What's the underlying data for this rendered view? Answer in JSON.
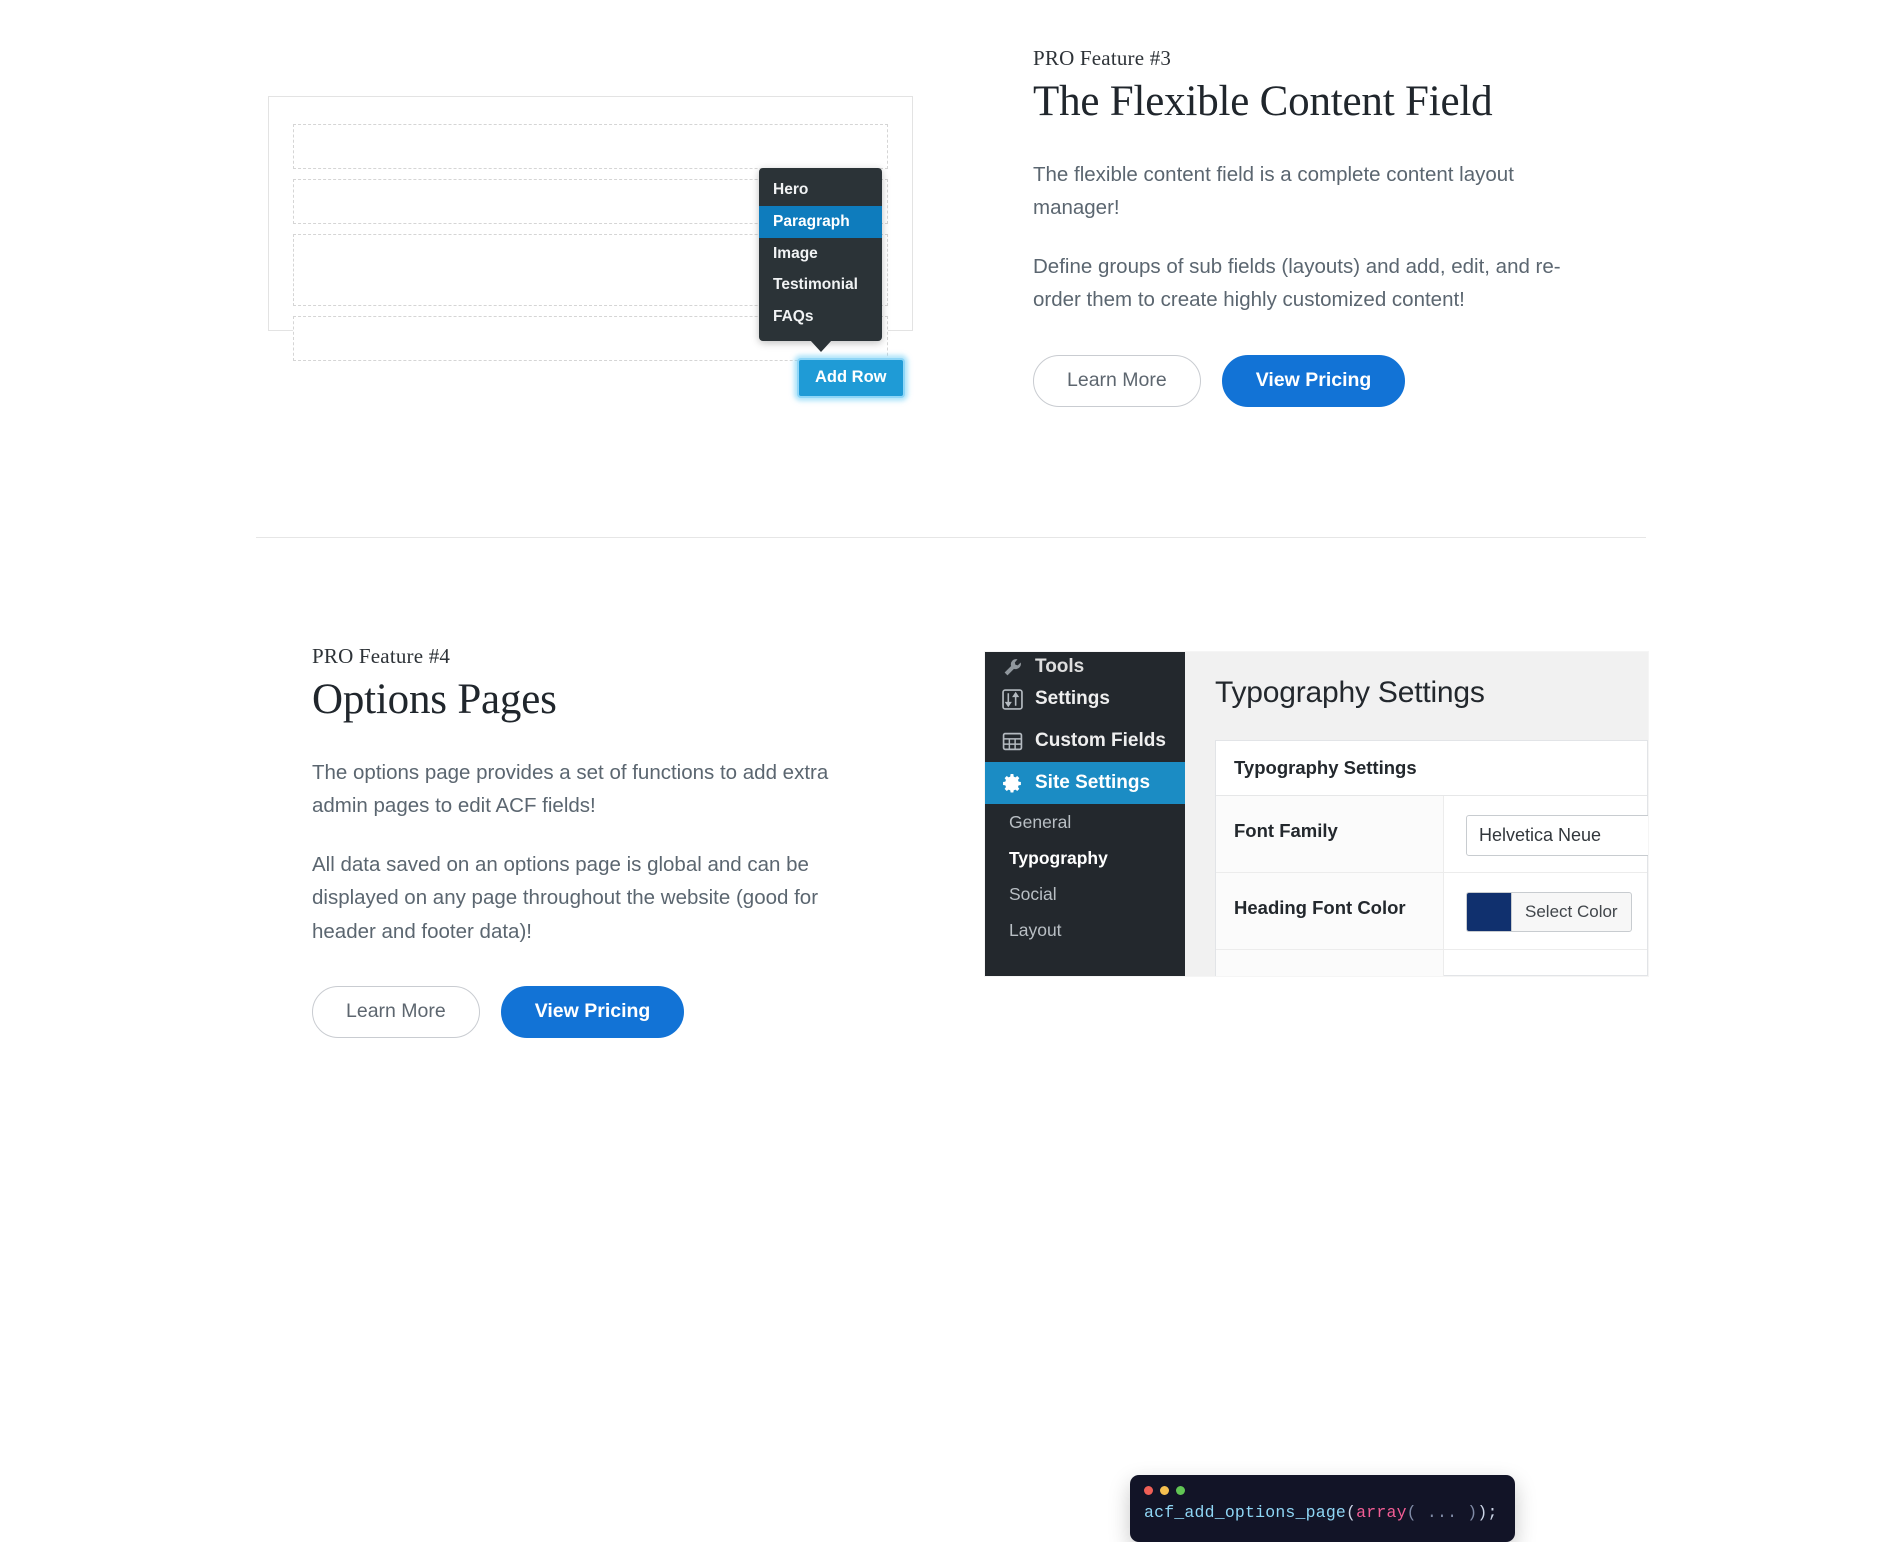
{
  "sections": [
    {
      "eyebrow": "PRO Feature #3",
      "title": "The Flexible Content Field",
      "paragraphs": [
        "The flexible content field is a complete content layout manager!",
        "Define groups of sub fields (layouts) and add, edit, and re-order them to create highly customized content!"
      ],
      "buttons": {
        "secondary": "Learn More",
        "primary": "View Pricing"
      }
    },
    {
      "eyebrow": "PRO Feature #4",
      "title": "Options Pages",
      "paragraphs": [
        "The options page provides a set of functions to add extra admin pages to edit ACF fields!",
        "All data saved on an options page is global and can be displayed on any page throughout the website (good for header and footer data)!"
      ],
      "buttons": {
        "secondary": "Learn More",
        "primary": "View Pricing"
      }
    }
  ],
  "flexible_content_mock": {
    "dropdown_items": [
      {
        "label": "Hero",
        "selected": false
      },
      {
        "label": "Paragraph",
        "selected": true
      },
      {
        "label": "Image",
        "selected": false
      },
      {
        "label": "Testimonial",
        "selected": false
      },
      {
        "label": "FAQs",
        "selected": false
      }
    ],
    "add_row_label": "Add Row"
  },
  "wp_screenshot": {
    "nav_items": [
      {
        "label": "Tools",
        "icon": "wrench-icon",
        "state": "partial"
      },
      {
        "label": "Settings",
        "icon": "sliders-icon",
        "state": "normal"
      },
      {
        "label": "Custom Fields",
        "icon": "table-icon",
        "state": "normal"
      },
      {
        "label": "Site Settings",
        "icon": "gear-icon",
        "state": "active"
      }
    ],
    "sub_items": [
      {
        "label": "General",
        "current": false
      },
      {
        "label": "Typography",
        "current": true
      },
      {
        "label": "Social",
        "current": false
      },
      {
        "label": "Layout",
        "current": false
      }
    ],
    "page_title": "Typography Settings",
    "metabox_title": "Typography Settings",
    "fields": [
      {
        "label": "Font Family",
        "type": "text",
        "value": "Helvetica Neue"
      },
      {
        "label": "Heading Font Color",
        "type": "color",
        "value": "#10306e",
        "button": "Select Color"
      }
    ]
  },
  "code_card": {
    "fn": "acf_add_options_page",
    "open_paren": "(",
    "kw": "array",
    "args": "(  ...  )",
    "close": ");"
  },
  "colors": {
    "primary_blue": "#1273d6",
    "dropdown_bg": "#2b3337",
    "dropdown_selected": "#0e7cbd",
    "add_row_blue": "#1f9bd6",
    "wp_sidebar": "#23282d",
    "wp_active": "#1b8cc4",
    "heading": "#20262c",
    "body_text": "#5b6670",
    "code_bg": "#121427"
  }
}
